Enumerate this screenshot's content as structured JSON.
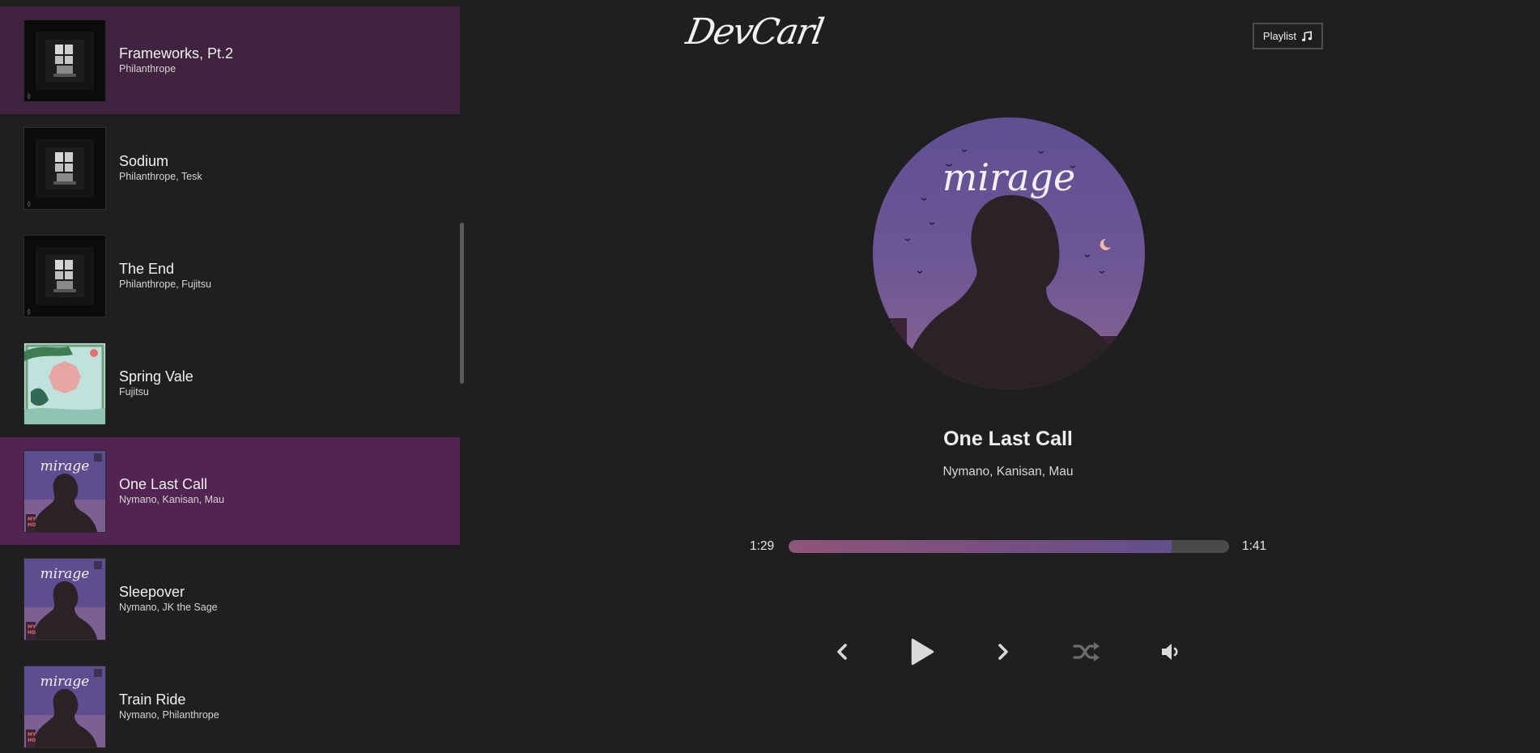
{
  "header": {
    "logo_text": "DevCarl",
    "playlist_button_label": "Playlist"
  },
  "playlist": [
    {
      "title": "Frameworks, Pt.2",
      "artist": "Philanthrope",
      "art": "dark-room",
      "state": "highlighted"
    },
    {
      "title": "Sodium",
      "artist": "Philanthrope, Tesk",
      "art": "dark-room",
      "state": "normal"
    },
    {
      "title": "The End",
      "artist": "Philanthrope, Fujitsu",
      "art": "dark-room",
      "state": "normal"
    },
    {
      "title": "Spring Vale",
      "artist": "Fujitsu",
      "art": "spring-landscape",
      "state": "normal"
    },
    {
      "title": "One Last Call",
      "artist": "Nymano, Kanisan, Mau",
      "art": "mirage",
      "state": "active"
    },
    {
      "title": "Sleepover",
      "artist": "Nymano, JK the Sage",
      "art": "mirage",
      "state": "normal"
    },
    {
      "title": "Train Ride",
      "artist": "Nymano, Philanthrope",
      "art": "mirage",
      "state": "normal"
    }
  ],
  "now_playing": {
    "title": "One Last Call",
    "artist": "Nymano, Kanisan, Mau",
    "cover_art": "mirage",
    "cover_text": "mirage",
    "current_time": "1:29",
    "total_time": "1:41",
    "progress": 0.87
  },
  "controls": {
    "prev_icon": "chevron-left-icon",
    "play_icon": "play-icon",
    "next_icon": "chevron-right-icon",
    "shuffle_icon": "shuffle-icon",
    "volume_icon": "volume-low-icon"
  },
  "colors": {
    "background": "#1f1f1f",
    "highlight_row": "#40233f",
    "active_row": "#522451",
    "progress_start": "#8e5577",
    "progress_end": "#62508b",
    "progress_track": "#4a4a4a"
  }
}
